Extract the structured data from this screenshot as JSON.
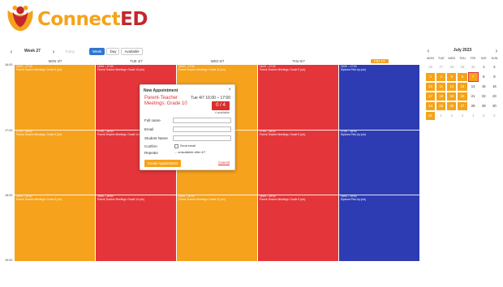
{
  "brand": {
    "name_part1": "Connect",
    "name_part2": "ED"
  },
  "toolbar": {
    "prev": "‹",
    "next": "›",
    "week_label": "Week 27",
    "today": "Today",
    "views": [
      "Week",
      "Day",
      "Available"
    ],
    "active_view": "Week"
  },
  "days": [
    "MON 3/7",
    "TUE 4/7",
    "WED 5/7",
    "THU 6/7",
    "FRI 7/7"
  ],
  "times": [
    "16:00",
    "17:00",
    "18:00",
    "19:00"
  ],
  "slots": {
    "mon": [
      "16:00 – 17:00",
      "Parent-Teacher Meetings: Grade 8 (o/o)",
      "17:00 – 18:00",
      "Parent-Teacher Meetings: Grade 8 (o/o)",
      "18:00 – 19:00",
      "Parent-Teacher Meetings: Grade 8 (o/o)"
    ],
    "tue": [
      "16:00 – 17:00",
      "Parent-Teacher Meetings: Grade 10 (o/o)",
      "17:00 – 18:00",
      "Parent-Teacher Meetings: Grade 10 (o/o)",
      "18:00 – 19:00",
      "Parent-Teacher Meetings: Grade 10 (o/o)"
    ],
    "wed": [
      "16:00 – 17:00",
      "Parent-Teacher Meetings: Grade 11 (o/o)",
      "17:00 – 18:00",
      "Parent-Teacher Meetings: Grade 11 (o/o)",
      "18:00 – 19:00",
      "Parent-Teacher Meetings: Grade 11 (o/o)"
    ],
    "thu": [
      "16:00 – 17:00",
      "Parent-Teacher Meetings: Grade 9 (o/o)",
      "17:00 – 18:00",
      "Parent-Teacher Meetings: Grade 9 (o/o)",
      "18:00 – 19:00",
      "Parent-Teacher Meetings: Grade 9 (o/o)"
    ],
    "fri": [
      "16:00 – 17:00",
      "Diploma Pick-Up (o/o)",
      "17:00 – 18:00",
      "Diploma Pick-Up (o/o)",
      "18:00 – 19:00",
      "Diploma Pick-Up (o/o)"
    ]
  },
  "colors": {
    "orange": "#f6a21c",
    "red": "#e4363a",
    "blue": "#2d3cb3",
    "accent": "#2f76d2"
  },
  "modal": {
    "title": "New Appointment",
    "close": "×",
    "event_name": "Parent-Teacher Meetings: Grade 10",
    "event_time": "Tue 4/7   16:00 – 17:00",
    "count": "0 / 4",
    "available": "4 available",
    "fields": [
      "Full name",
      "Email",
      "Student Name",
      "Confirm",
      "Repeats"
    ],
    "send_email": "Send email",
    "repeats_text": "... unavailable after 4/7",
    "create": "Create Appointment",
    "cancel": "Cancel"
  },
  "mini_month": {
    "title": "July 2023",
    "prev": "‹",
    "next": "›",
    "dow": [
      "MON",
      "TUE",
      "WED",
      "THU",
      "FRI",
      "SAT",
      "SUN"
    ],
    "weeks": [
      [
        "26",
        "27",
        "28",
        "29",
        "30",
        "1",
        "2"
      ],
      [
        "3",
        "4",
        "5",
        "6",
        "7",
        "8",
        "9"
      ],
      [
        "10",
        "11",
        "12",
        "13",
        "14",
        "15",
        "16"
      ],
      [
        "17",
        "18",
        "19",
        "20",
        "21",
        "22",
        "23"
      ],
      [
        "24",
        "25",
        "26",
        "27",
        "28",
        "29",
        "30"
      ],
      [
        "31",
        "1",
        "2",
        "3",
        "4",
        "5",
        "6"
      ]
    ]
  }
}
